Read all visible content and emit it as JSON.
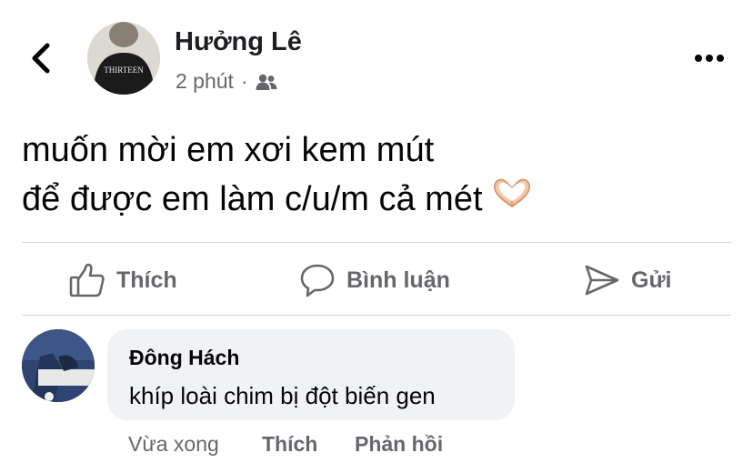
{
  "post": {
    "author": "Hưởng Lê",
    "time": "2 phút",
    "separator": "·",
    "audience_icon": "friends-icon",
    "text_lines": [
      "muốn mời em xơi kem mút",
      "để được em làm c/u/m cả mét"
    ],
    "emoji_icon": "heart-hands-icon",
    "avatar_shirt_text": "THIRTEEN"
  },
  "actions": {
    "like_label": "Thích",
    "comment_label": "Bình luận",
    "send_label": "Gửi"
  },
  "comment": {
    "author": "Đông Hách",
    "text": "khíp loài chim bị đột biến gen",
    "time": "Vừa xong",
    "like_label": "Thích",
    "reply_label": "Phản hồi"
  },
  "colors": {
    "text_primary": "#050505",
    "text_secondary": "#65676b",
    "bubble": "#f0f2f5",
    "divider": "#d4d6d9"
  }
}
